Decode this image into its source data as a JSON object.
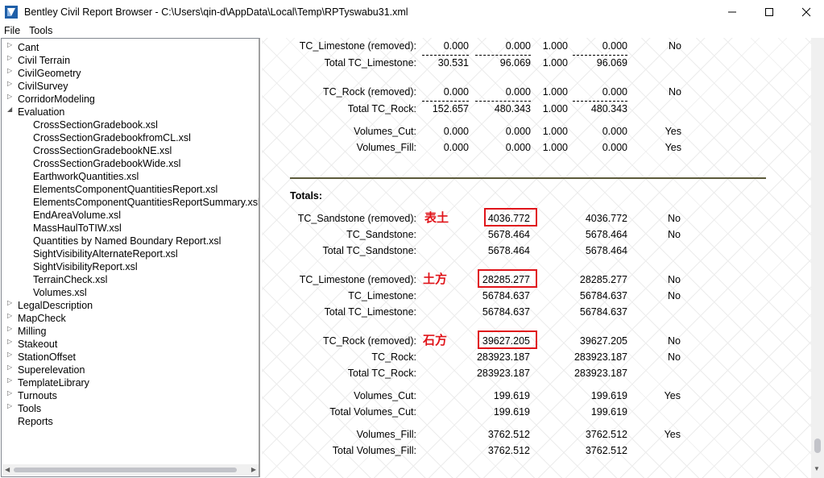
{
  "window": {
    "title": "Bentley Civil Report Browser - C:\\Users\\qin-d\\AppData\\Local\\Temp\\RPTyswabu31.xml",
    "icon": "bentley-app-icon"
  },
  "menu": {
    "file": "File",
    "tools": "Tools"
  },
  "tree": {
    "top": [
      {
        "label": "Cant",
        "expanded": false
      },
      {
        "label": "Civil Terrain",
        "expanded": false
      },
      {
        "label": "CivilGeometry",
        "expanded": false
      },
      {
        "label": "CivilSurvey",
        "expanded": false
      },
      {
        "label": "CorridorModeling",
        "expanded": false
      },
      {
        "label": "Evaluation",
        "expanded": true
      }
    ],
    "evaluation_children": [
      "CrossSectionGradebook.xsl",
      "CrossSectionGradebookfromCL.xsl",
      "CrossSectionGradebookNE.xsl",
      "CrossSectionGradebookWide.xsl",
      "EarthworkQuantities.xsl",
      "ElementsComponentQuantitiesReport.xsl",
      "ElementsComponentQuantitiesReportSummary.xsl",
      "EndAreaVolume.xsl",
      "MassHaulToTIW.xsl",
      "Quantities by Named Boundary Report.xsl",
      "SightVisibilityAlternateReport.xsl",
      "SightVisibilityReport.xsl",
      "TerrainCheck.xsl",
      "Volumes.xsl"
    ],
    "bottom": [
      {
        "label": "LegalDescription",
        "expanded": false
      },
      {
        "label": "MapCheck",
        "expanded": false
      },
      {
        "label": "Milling",
        "expanded": false
      },
      {
        "label": "Stakeout",
        "expanded": false
      },
      {
        "label": "StationOffset",
        "expanded": false
      },
      {
        "label": "Superelevation",
        "expanded": false
      },
      {
        "label": "TemplateLibrary",
        "expanded": false
      },
      {
        "label": "Turnouts",
        "expanded": false
      },
      {
        "label": "Tools",
        "expanded": false
      },
      {
        "label": "Reports",
        "expanded": null
      }
    ]
  },
  "report": {
    "top_rows": [
      {
        "label": "TC_Limestone (removed):",
        "v1": "0.000",
        "v2": "0.000",
        "v3": "1.000",
        "v4": "0.000",
        "flag": "No",
        "dashed": true
      },
      {
        "label": "Total TC_Limestone:",
        "v1": "30.531",
        "v2": "96.069",
        "v3": "1.000",
        "v4": "96.069",
        "flag": "",
        "dashed": false
      },
      {
        "label": "TC_Rock (removed):",
        "v1": "0.000",
        "v2": "0.000",
        "v3": "1.000",
        "v4": "0.000",
        "flag": "No",
        "dashed": true
      },
      {
        "label": "Total TC_Rock:",
        "v1": "152.657",
        "v2": "480.343",
        "v3": "1.000",
        "v4": "480.343",
        "flag": "",
        "dashed": false
      },
      {
        "label": "Volumes_Cut:",
        "v1": "0.000",
        "v2": "0.000",
        "v3": "1.000",
        "v4": "0.000",
        "flag": "Yes",
        "dashed": false
      },
      {
        "label": "Volumes_Fill:",
        "v1": "0.000",
        "v2": "0.000",
        "v3": "1.000",
        "v4": "0.000",
        "flag": "Yes",
        "dashed": false
      }
    ],
    "totals_heading": "Totals:",
    "totals_rows": [
      {
        "label": "TC_Sandstone (removed):",
        "v1": "4036.772",
        "v2": "4036.772",
        "flag": "No",
        "highlight": true,
        "annotation": "表土"
      },
      {
        "label": "TC_Sandstone:",
        "v1": "5678.464",
        "v2": "5678.464",
        "flag": "No",
        "highlight": false,
        "annotation": ""
      },
      {
        "label": "Total TC_Sandstone:",
        "v1": "5678.464",
        "v2": "5678.464",
        "flag": "",
        "highlight": false,
        "annotation": ""
      },
      {
        "label": "TC_Limestone (removed):",
        "v1": "28285.277",
        "v2": "28285.277",
        "flag": "No",
        "highlight": true,
        "annotation": "土方"
      },
      {
        "label": "TC_Limestone:",
        "v1": "56784.637",
        "v2": "56784.637",
        "flag": "No",
        "highlight": false,
        "annotation": ""
      },
      {
        "label": "Total TC_Limestone:",
        "v1": "56784.637",
        "v2": "56784.637",
        "flag": "",
        "highlight": false,
        "annotation": ""
      },
      {
        "label": "TC_Rock (removed):",
        "v1": "39627.205",
        "v2": "39627.205",
        "flag": "No",
        "highlight": true,
        "annotation": "石方"
      },
      {
        "label": "TC_Rock:",
        "v1": "283923.187",
        "v2": "283923.187",
        "flag": "No",
        "highlight": false,
        "annotation": ""
      },
      {
        "label": "Total TC_Rock:",
        "v1": "283923.187",
        "v2": "283923.187",
        "flag": "",
        "highlight": false,
        "annotation": ""
      },
      {
        "label": "Volumes_Cut:",
        "v1": "199.619",
        "v2": "199.619",
        "flag": "Yes",
        "highlight": false,
        "annotation": ""
      },
      {
        "label": "Total Volumes_Cut:",
        "v1": "199.619",
        "v2": "199.619",
        "flag": "",
        "highlight": false,
        "annotation": ""
      },
      {
        "label": "Volumes_Fill:",
        "v1": "3762.512",
        "v2": "3762.512",
        "flag": "Yes",
        "highlight": false,
        "annotation": ""
      },
      {
        "label": "Total Volumes_Fill:",
        "v1": "3762.512",
        "v2": "3762.512",
        "flag": "",
        "highlight": false,
        "annotation": ""
      }
    ]
  },
  "colors": {
    "highlight_box": "#e0141a",
    "annotation_text": "#e0141a",
    "divider": "#5c5a3a"
  }
}
